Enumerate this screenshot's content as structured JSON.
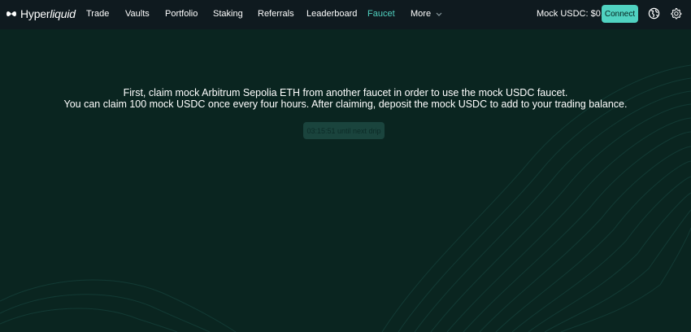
{
  "app": {
    "brand_main": "Hyper",
    "brand_italic": "liquid",
    "logo_icon": "hyperliquid-logo-icon"
  },
  "nav": {
    "items": [
      {
        "label": "Trade",
        "active": false
      },
      {
        "label": "Vaults",
        "active": false
      },
      {
        "label": "Portfolio",
        "active": false
      },
      {
        "label": "Staking",
        "active": false
      },
      {
        "label": "Referrals",
        "active": false
      },
      {
        "label": "Leaderboard",
        "active": false
      },
      {
        "label": "Faucet",
        "active": true
      },
      {
        "label": "More",
        "active": false,
        "icon": "chevron-down-icon"
      }
    ]
  },
  "header": {
    "balance": "Mock USDC: $0.00",
    "connect_label": "Connect",
    "globe_icon": "globe-icon",
    "settings_icon": "gear-icon"
  },
  "faucet": {
    "line1": "First, claim mock Arbitrum Sepolia ETH from another faucet in order to use the mock USDC faucet.",
    "line2": "You can claim 100 mock USDC once every four hours. After claiming, deposit the mock USDC to add to your trading balance.",
    "drip_button": "03:15:51 until next drip"
  },
  "colors": {
    "background": "#0a2520",
    "navbar": "#0f1a1f",
    "accent": "#50d2c1",
    "disabled_button": "#1a443d"
  }
}
